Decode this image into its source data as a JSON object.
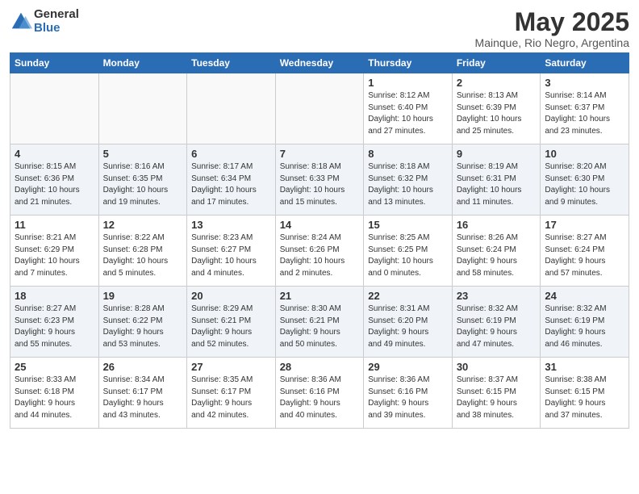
{
  "logo": {
    "general": "General",
    "blue": "Blue"
  },
  "title": "May 2025",
  "subtitle": "Mainque, Rio Negro, Argentina",
  "days_header": [
    "Sunday",
    "Monday",
    "Tuesday",
    "Wednesday",
    "Thursday",
    "Friday",
    "Saturday"
  ],
  "weeks": [
    [
      {
        "day": "",
        "info": ""
      },
      {
        "day": "",
        "info": ""
      },
      {
        "day": "",
        "info": ""
      },
      {
        "day": "",
        "info": ""
      },
      {
        "day": "1",
        "info": "Sunrise: 8:12 AM\nSunset: 6:40 PM\nDaylight: 10 hours\nand 27 minutes."
      },
      {
        "day": "2",
        "info": "Sunrise: 8:13 AM\nSunset: 6:39 PM\nDaylight: 10 hours\nand 25 minutes."
      },
      {
        "day": "3",
        "info": "Sunrise: 8:14 AM\nSunset: 6:37 PM\nDaylight: 10 hours\nand 23 minutes."
      }
    ],
    [
      {
        "day": "4",
        "info": "Sunrise: 8:15 AM\nSunset: 6:36 PM\nDaylight: 10 hours\nand 21 minutes."
      },
      {
        "day": "5",
        "info": "Sunrise: 8:16 AM\nSunset: 6:35 PM\nDaylight: 10 hours\nand 19 minutes."
      },
      {
        "day": "6",
        "info": "Sunrise: 8:17 AM\nSunset: 6:34 PM\nDaylight: 10 hours\nand 17 minutes."
      },
      {
        "day": "7",
        "info": "Sunrise: 8:18 AM\nSunset: 6:33 PM\nDaylight: 10 hours\nand 15 minutes."
      },
      {
        "day": "8",
        "info": "Sunrise: 8:18 AM\nSunset: 6:32 PM\nDaylight: 10 hours\nand 13 minutes."
      },
      {
        "day": "9",
        "info": "Sunrise: 8:19 AM\nSunset: 6:31 PM\nDaylight: 10 hours\nand 11 minutes."
      },
      {
        "day": "10",
        "info": "Sunrise: 8:20 AM\nSunset: 6:30 PM\nDaylight: 10 hours\nand 9 minutes."
      }
    ],
    [
      {
        "day": "11",
        "info": "Sunrise: 8:21 AM\nSunset: 6:29 PM\nDaylight: 10 hours\nand 7 minutes."
      },
      {
        "day": "12",
        "info": "Sunrise: 8:22 AM\nSunset: 6:28 PM\nDaylight: 10 hours\nand 5 minutes."
      },
      {
        "day": "13",
        "info": "Sunrise: 8:23 AM\nSunset: 6:27 PM\nDaylight: 10 hours\nand 4 minutes."
      },
      {
        "day": "14",
        "info": "Sunrise: 8:24 AM\nSunset: 6:26 PM\nDaylight: 10 hours\nand 2 minutes."
      },
      {
        "day": "15",
        "info": "Sunrise: 8:25 AM\nSunset: 6:25 PM\nDaylight: 10 hours\nand 0 minutes."
      },
      {
        "day": "16",
        "info": "Sunrise: 8:26 AM\nSunset: 6:24 PM\nDaylight: 9 hours\nand 58 minutes."
      },
      {
        "day": "17",
        "info": "Sunrise: 8:27 AM\nSunset: 6:24 PM\nDaylight: 9 hours\nand 57 minutes."
      }
    ],
    [
      {
        "day": "18",
        "info": "Sunrise: 8:27 AM\nSunset: 6:23 PM\nDaylight: 9 hours\nand 55 minutes."
      },
      {
        "day": "19",
        "info": "Sunrise: 8:28 AM\nSunset: 6:22 PM\nDaylight: 9 hours\nand 53 minutes."
      },
      {
        "day": "20",
        "info": "Sunrise: 8:29 AM\nSunset: 6:21 PM\nDaylight: 9 hours\nand 52 minutes."
      },
      {
        "day": "21",
        "info": "Sunrise: 8:30 AM\nSunset: 6:21 PM\nDaylight: 9 hours\nand 50 minutes."
      },
      {
        "day": "22",
        "info": "Sunrise: 8:31 AM\nSunset: 6:20 PM\nDaylight: 9 hours\nand 49 minutes."
      },
      {
        "day": "23",
        "info": "Sunrise: 8:32 AM\nSunset: 6:19 PM\nDaylight: 9 hours\nand 47 minutes."
      },
      {
        "day": "24",
        "info": "Sunrise: 8:32 AM\nSunset: 6:19 PM\nDaylight: 9 hours\nand 46 minutes."
      }
    ],
    [
      {
        "day": "25",
        "info": "Sunrise: 8:33 AM\nSunset: 6:18 PM\nDaylight: 9 hours\nand 44 minutes."
      },
      {
        "day": "26",
        "info": "Sunrise: 8:34 AM\nSunset: 6:17 PM\nDaylight: 9 hours\nand 43 minutes."
      },
      {
        "day": "27",
        "info": "Sunrise: 8:35 AM\nSunset: 6:17 PM\nDaylight: 9 hours\nand 42 minutes."
      },
      {
        "day": "28",
        "info": "Sunrise: 8:36 AM\nSunset: 6:16 PM\nDaylight: 9 hours\nand 40 minutes."
      },
      {
        "day": "29",
        "info": "Sunrise: 8:36 AM\nSunset: 6:16 PM\nDaylight: 9 hours\nand 39 minutes."
      },
      {
        "day": "30",
        "info": "Sunrise: 8:37 AM\nSunset: 6:15 PM\nDaylight: 9 hours\nand 38 minutes."
      },
      {
        "day": "31",
        "info": "Sunrise: 8:38 AM\nSunset: 6:15 PM\nDaylight: 9 hours\nand 37 minutes."
      }
    ]
  ]
}
